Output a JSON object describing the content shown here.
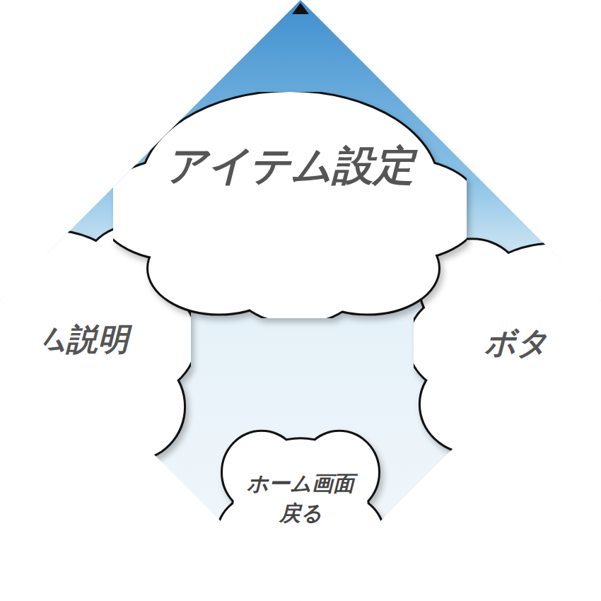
{
  "top_cloud": {
    "label": "アイテム設定"
  },
  "left_cloud": {
    "label": "ム説明"
  },
  "right_cloud": {
    "label": "ボタ"
  },
  "bottom_cloud": {
    "lines": [
      "ホーム画面",
      "戻る"
    ]
  }
}
